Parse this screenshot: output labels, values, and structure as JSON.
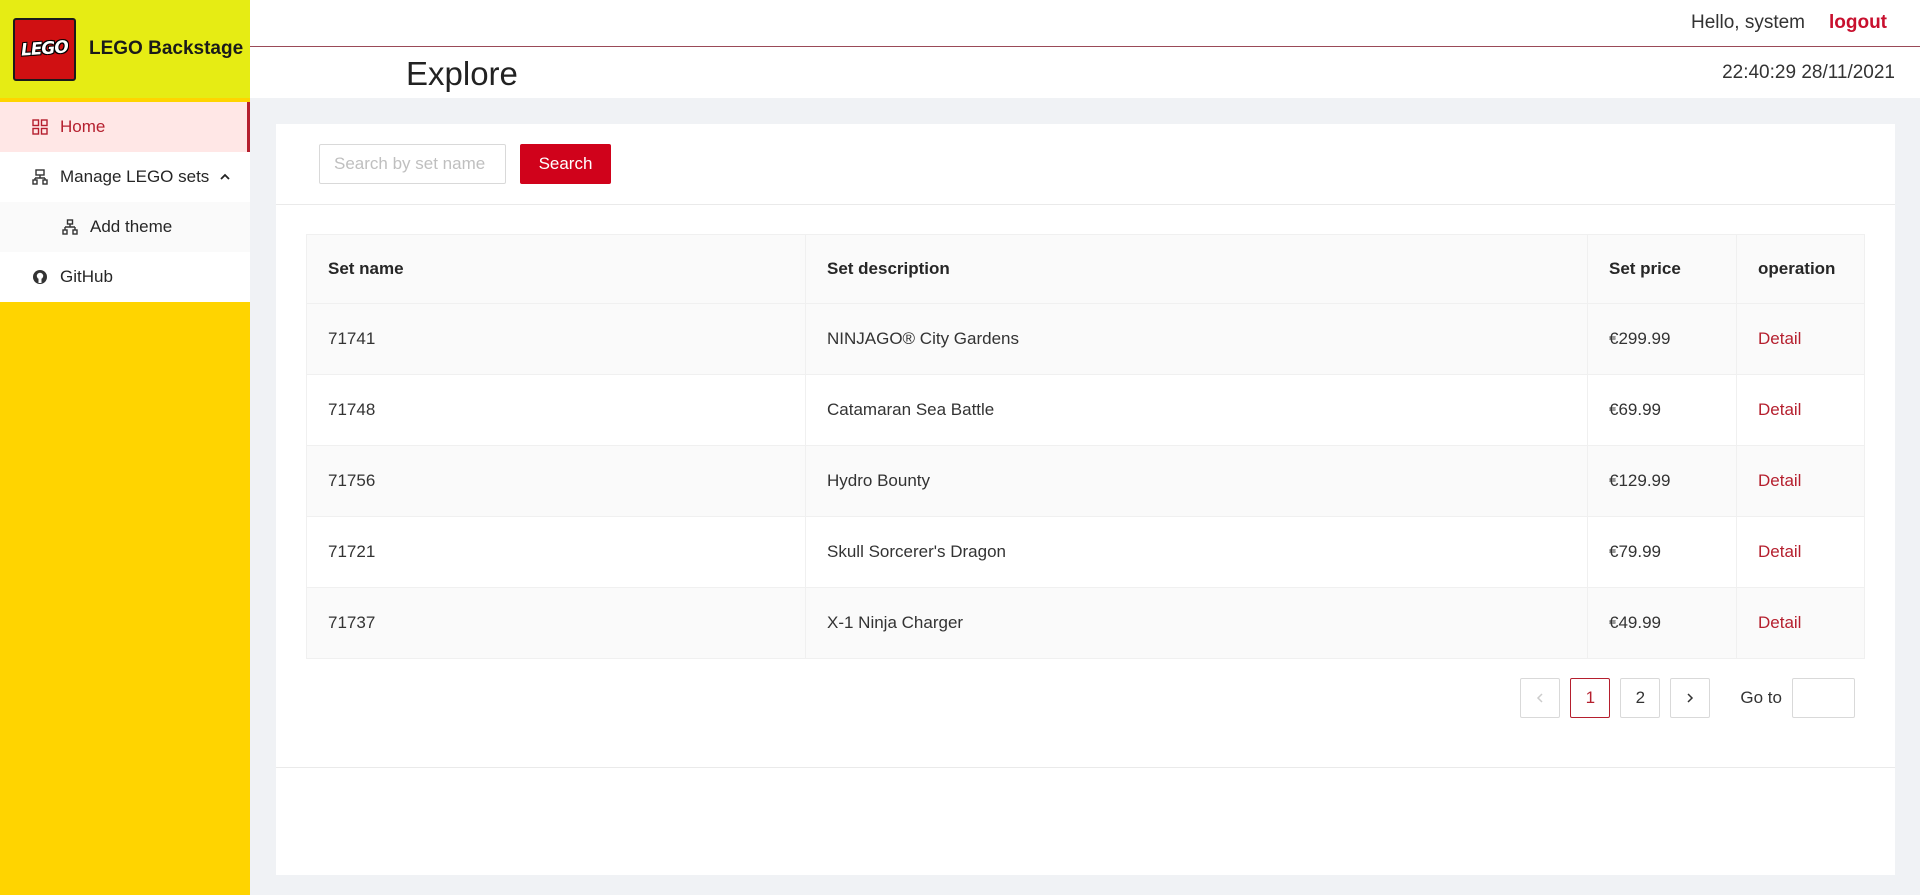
{
  "brand": {
    "logo_text": "LEGO",
    "title": "LEGO Backstage"
  },
  "sidebar": {
    "items": [
      {
        "label": "Home",
        "icon": "appstore-icon"
      },
      {
        "label": "Manage LEGO sets",
        "icon": "cluster-icon"
      },
      {
        "label": "Add theme",
        "icon": "apartment-icon"
      },
      {
        "label": "GitHub",
        "icon": "github-icon"
      }
    ]
  },
  "header": {
    "greeting": "Hello, system",
    "logout": "logout",
    "page_title": "Explore",
    "datetime": "22:40:29 28/11/2021"
  },
  "search": {
    "placeholder": "Search by set name",
    "button": "Search"
  },
  "table": {
    "columns": [
      "Set name",
      "Set description",
      "Set price",
      "operation"
    ],
    "rows": [
      {
        "name": "71741",
        "description": "NINJAGO® City Gardens",
        "price": "€299.99",
        "action": "Detail"
      },
      {
        "name": "71748",
        "description": "Catamaran Sea Battle",
        "price": "€69.99",
        "action": "Detail"
      },
      {
        "name": "71756",
        "description": "Hydro Bounty",
        "price": "€129.99",
        "action": "Detail"
      },
      {
        "name": "71721",
        "description": "Skull Sorcerer's Dragon",
        "price": "€79.99",
        "action": "Detail"
      },
      {
        "name": "71737",
        "description": "X-1 Ninja Charger",
        "price": "€49.99",
        "action": "Detail"
      }
    ]
  },
  "pagination": {
    "pages": [
      "1",
      "2"
    ],
    "current": "1",
    "goto_label": "Go to"
  },
  "colors": {
    "accent": "#b51f2e",
    "primary_button": "#d0021b",
    "sidebar": "#ffd400",
    "brand_bar": "#e6ec14"
  }
}
